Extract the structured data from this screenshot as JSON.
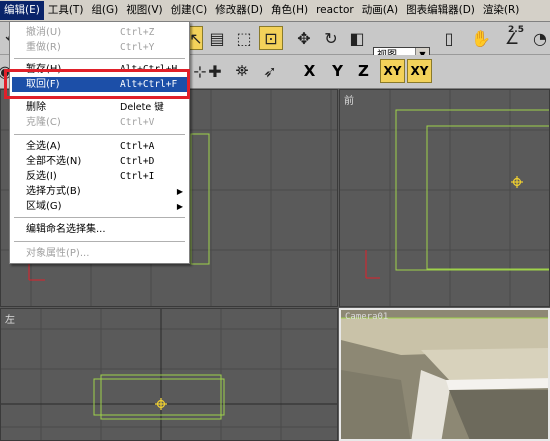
{
  "menubar": {
    "items": [
      "编辑(E)",
      "工具(T)",
      "组(G)",
      "视图(V)",
      "创建(C)",
      "修改器(D)",
      "角色(H)",
      "reactor",
      "动画(A)",
      "图表编辑器(D)",
      "渲染(R)"
    ]
  },
  "toolbar": {
    "view_select": "视图",
    "axes": [
      "X",
      "Y",
      "Z",
      "XY",
      "XY"
    ],
    "spinner_label": "2.5"
  },
  "edit_menu": {
    "items": [
      {
        "label": "撤消(U)",
        "shortcut": "Ctrl+Z",
        "disabled": true
      },
      {
        "label": "重做(R)",
        "shortcut": "Ctrl+Y",
        "disabled": true
      },
      {
        "label": "暂存(H)",
        "shortcut": "Alt+Ctrl+H",
        "disabled": false
      },
      {
        "label": "取回(F)",
        "shortcut": "Alt+Ctrl+F",
        "disabled": false
      },
      {
        "label": "删除",
        "shortcut": "Delete 键",
        "disabled": false
      },
      {
        "label": "克隆(C)",
        "shortcut": "Ctrl+V",
        "disabled": true
      },
      {
        "label": "全选(A)",
        "shortcut": "Ctrl+A",
        "disabled": false
      },
      {
        "label": "全部不选(N)",
        "shortcut": "Ctrl+D",
        "disabled": false
      },
      {
        "label": "反选(I)",
        "shortcut": "Ctrl+I",
        "disabled": false
      },
      {
        "label": "选择方式(B)",
        "shortcut": "",
        "disabled": false
      },
      {
        "label": "区域(G)",
        "shortcut": "",
        "disabled": false
      },
      {
        "label": "编辑命名选择集...",
        "shortcut": "",
        "disabled": false
      },
      {
        "label": "对象属性(P)...",
        "shortcut": "",
        "disabled": true
      }
    ]
  },
  "viewports": {
    "front": "前",
    "left": "左",
    "camera": "Camera01"
  },
  "colors": {
    "accent_highlight": "#1c4fa8",
    "callout": "#e0202a",
    "wireframe": "#9fd24a",
    "selected_button": "#f3d25a"
  }
}
